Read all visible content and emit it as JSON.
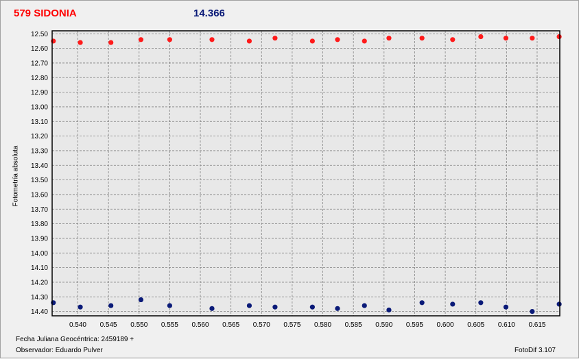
{
  "header": {
    "object_name": "579 SIDONIA",
    "comparison_value": "14.366"
  },
  "footer": {
    "julian_label": "Fecha Juliana Geocéntrica: 2459189 +",
    "observer_label": "Observador: Eduardo Pulver",
    "software": "FotoDif 3.107"
  },
  "colors": {
    "series_red": "#ff1a1a",
    "series_blue": "#0a1a78",
    "plot_bg": "#e8e8e8",
    "grid": "#808080"
  },
  "chart_data": {
    "type": "scatter",
    "title": "",
    "xlabel": "",
    "ylabel": "Fotometría absoluta",
    "xlim": [
      0.5358,
      0.6187
    ],
    "ylim": [
      12.48,
      14.43
    ],
    "y_inverted": true,
    "grid": true,
    "x_ticks": [
      "0.540",
      "0.545",
      "0.550",
      "0.555",
      "0.560",
      "0.565",
      "0.570",
      "0.575",
      "0.580",
      "0.585",
      "0.590",
      "0.595",
      "0.600",
      "0.605",
      "0.610",
      "0.615"
    ],
    "x_tick_values": [
      0.54,
      0.545,
      0.55,
      0.555,
      0.56,
      0.565,
      0.57,
      0.575,
      0.58,
      0.585,
      0.59,
      0.595,
      0.6,
      0.605,
      0.61,
      0.615
    ],
    "y_ticks": [
      "12.50",
      "12.60",
      "12.70",
      "12.80",
      "12.90",
      "13.00",
      "13.10",
      "13.20",
      "13.30",
      "13.40",
      "13.50",
      "13.60",
      "13.70",
      "13.80",
      "13.90",
      "14.00",
      "14.10",
      "14.20",
      "14.30",
      "14.40"
    ],
    "y_tick_values": [
      12.5,
      12.6,
      12.7,
      12.8,
      12.9,
      13.0,
      13.1,
      13.2,
      13.3,
      13.4,
      13.5,
      13.6,
      13.7,
      13.8,
      13.9,
      14.0,
      14.1,
      14.2,
      14.3,
      14.4
    ],
    "series": [
      {
        "color": "#ff1a1a",
        "points": [
          [
            0.536,
            12.55
          ],
          [
            0.5404,
            12.56
          ],
          [
            0.5454,
            12.56
          ],
          [
            0.5503,
            12.54
          ],
          [
            0.555,
            12.54
          ],
          [
            0.5619,
            12.54
          ],
          [
            0.568,
            12.55
          ],
          [
            0.5722,
            12.53
          ],
          [
            0.5783,
            12.55
          ],
          [
            0.5824,
            12.54
          ],
          [
            0.5868,
            12.55
          ],
          [
            0.5908,
            12.53
          ],
          [
            0.5962,
            12.53
          ],
          [
            0.6012,
            12.54
          ],
          [
            0.6058,
            12.52
          ],
          [
            0.6099,
            12.53
          ],
          [
            0.6142,
            12.53
          ],
          [
            0.6186,
            12.52
          ]
        ]
      },
      {
        "color": "#0a1a78",
        "points": [
          [
            0.536,
            14.34
          ],
          [
            0.5404,
            14.37
          ],
          [
            0.5454,
            14.36
          ],
          [
            0.5503,
            14.32
          ],
          [
            0.555,
            14.36
          ],
          [
            0.5619,
            14.38
          ],
          [
            0.568,
            14.36
          ],
          [
            0.5722,
            14.37
          ],
          [
            0.5783,
            14.37
          ],
          [
            0.5824,
            14.38
          ],
          [
            0.5868,
            14.36
          ],
          [
            0.5908,
            14.39
          ],
          [
            0.5962,
            14.34
          ],
          [
            0.6012,
            14.35
          ],
          [
            0.6058,
            14.34
          ],
          [
            0.6099,
            14.37
          ],
          [
            0.6142,
            14.4
          ],
          [
            0.6186,
            14.35
          ]
        ]
      }
    ]
  }
}
